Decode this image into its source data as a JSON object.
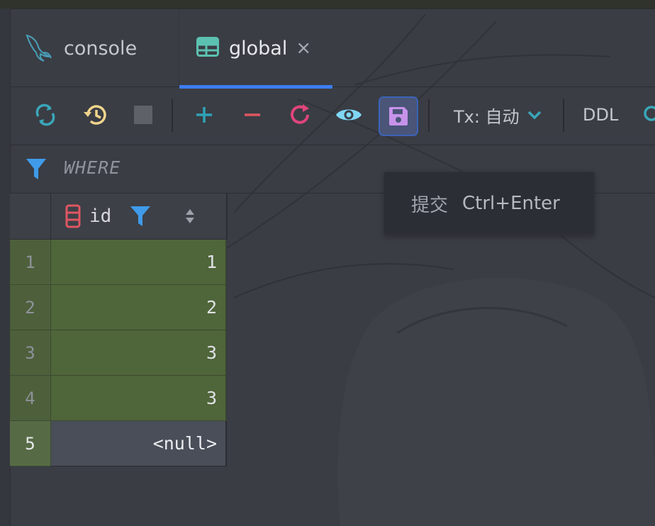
{
  "tabs": [
    {
      "label": "console",
      "icon": "mysql-dolphin-icon",
      "active": false
    },
    {
      "label": "global",
      "icon": "table-icon",
      "active": true,
      "closable": true
    }
  ],
  "tab_close_glyph": "×",
  "toolbar": {
    "buttons": [
      {
        "name": "refresh",
        "icon": "sync-arrows-icon",
        "color": "#3aa6b9"
      },
      {
        "name": "history",
        "icon": "history-clock-icon",
        "color": "#f0d58c"
      },
      {
        "name": "stop",
        "icon": "stop-square-icon",
        "color": "#5f6168"
      },
      {
        "name": "add-row",
        "icon": "plus-icon",
        "color": "#2ea4b7"
      },
      {
        "name": "delete-row",
        "icon": "minus-icon",
        "color": "#e05661"
      },
      {
        "name": "revert",
        "icon": "reload-icon",
        "color": "#e0457b"
      },
      {
        "name": "view",
        "icon": "eye-icon",
        "color": "#7fd7f5"
      },
      {
        "name": "submit",
        "icon": "save-icon",
        "color": "#c792ea",
        "pressed": true
      }
    ],
    "tx_label": "Tx: 自动",
    "ddl_label": "DDL"
  },
  "filter": {
    "where_label": "WHERE",
    "icon": "filter-funnel-icon"
  },
  "grid": {
    "columns": [
      {
        "name": "id",
        "icon": "column-key-icon",
        "filter_icon": "filter-funnel-icon",
        "sort_icon": "sort-updown-icon"
      }
    ],
    "rows": [
      {
        "num": "1",
        "id": "1",
        "state": "inserted"
      },
      {
        "num": "2",
        "id": "2",
        "state": "inserted"
      },
      {
        "num": "3",
        "id": "3",
        "state": "inserted"
      },
      {
        "num": "4",
        "id": "3",
        "state": "inserted"
      },
      {
        "num": "5",
        "id": "<null>",
        "state": "selected"
      }
    ]
  },
  "tooltip": {
    "text": "提交",
    "shortcut": "Ctrl+Enter"
  },
  "colors": {
    "accent_blue": "#3d7df0",
    "row_inserted_green": "#546e38",
    "background": "#3a3d44"
  }
}
